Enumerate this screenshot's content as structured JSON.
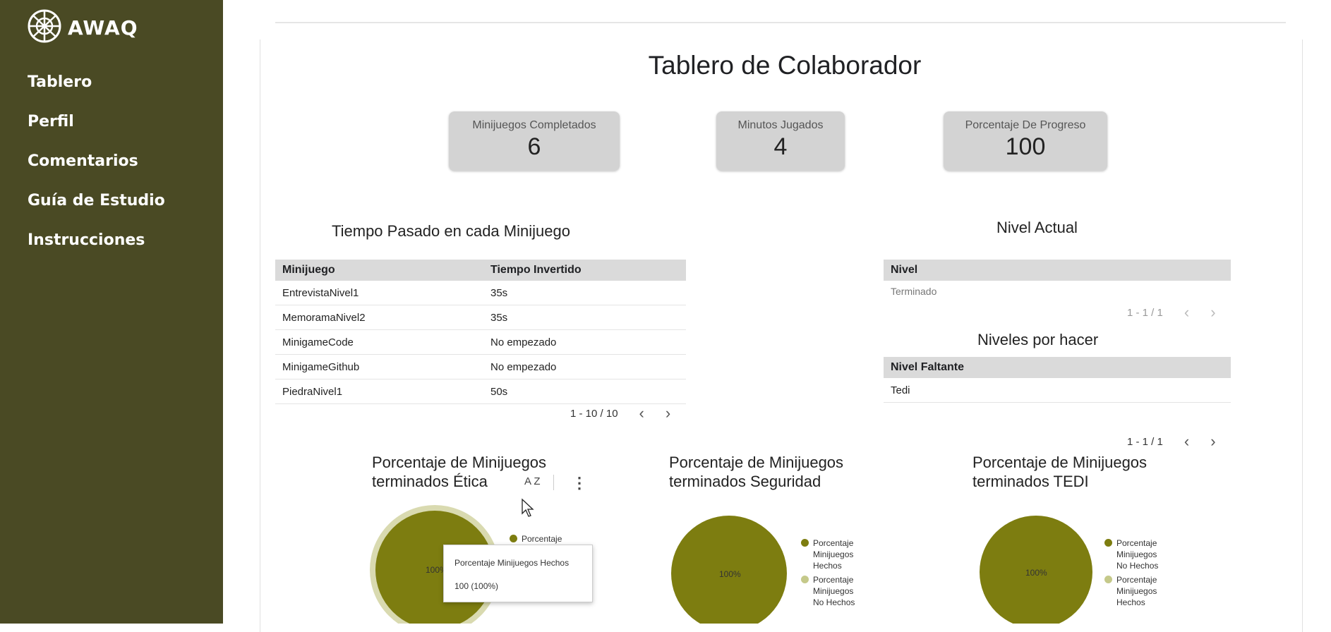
{
  "app": {
    "logo_text": "AWAQ"
  },
  "sidebar": {
    "items": [
      {
        "label": "Tablero"
      },
      {
        "label": "Perfil"
      },
      {
        "label": "Comentarios"
      },
      {
        "label": "Guía de Estudio"
      },
      {
        "label": "Instrucciones"
      }
    ]
  },
  "main": {
    "title": "Tablero de Colaborador",
    "kpis": [
      {
        "label": "Minijuegos Completados",
        "value": "6"
      },
      {
        "label": "Minutos Jugados",
        "value": "4"
      },
      {
        "label": "Porcentaje De Progreso",
        "value": "100"
      }
    ],
    "time_table": {
      "title": "Tiempo Pasado en cada Minijuego",
      "headers": [
        "Minijuego",
        "Tiempo Invertido"
      ],
      "rows": [
        [
          "EntrevistaNivel1",
          "35s"
        ],
        [
          "MemoramaNivel2",
          "35s"
        ],
        [
          "MinigameCode",
          "No empezado"
        ],
        [
          "MinigameGithub",
          "No empezado"
        ],
        [
          "PiedraNivel1",
          "50s"
        ]
      ],
      "pager": "1 - 10 / 10"
    },
    "level_table": {
      "title": "Nivel Actual",
      "header": "Nivel",
      "rows": [
        "Terminado"
      ],
      "pager": "1 - 1 / 1"
    },
    "todo_table": {
      "title": "Niveles por hacer",
      "header": "Nivel Faltante",
      "rows": [
        "Tedi"
      ],
      "pager": "1 - 1 / 1"
    },
    "charts": [
      {
        "title_line1": "Porcentaje de Minijuegos",
        "title_line2": "terminados Ética",
        "slice_label": "100%",
        "legend": [
          {
            "label": "Porcentaje",
            "color": "#7d7d10"
          }
        ],
        "tooltip": {
          "line1": "Porcentaje Minijuegos Hechos",
          "line2": "100 (100%)"
        }
      },
      {
        "title_line1": "Porcentaje de Minijuegos",
        "title_line2": "terminados Seguridad",
        "slice_label": "100%",
        "legend": [
          {
            "line1": "Porcentaje",
            "line2": "Minijuegos",
            "line3": "Hechos",
            "color": "#7d7d10"
          },
          {
            "line1": "Porcentaje",
            "line2": "Minijuegos",
            "line3": "No Hechos",
            "color": "#c5c98a"
          }
        ]
      },
      {
        "title_line1": "Porcentaje de Minijuegos",
        "title_line2": "terminados TEDI",
        "slice_label": "100%",
        "legend": [
          {
            "line1": "Porcentaje",
            "line2": "Minijuegos",
            "line3": "No Hechos",
            "color": "#7d7d10"
          },
          {
            "line1": "Porcentaje",
            "line2": "Minijuegos",
            "line3": "Hechos",
            "color": "#c5c98a"
          }
        ]
      }
    ],
    "chart_toolbar": {
      "sort_glyph": "A Z"
    }
  },
  "colors": {
    "sidebar": "#4a4a24",
    "pie": "#7d7d10",
    "pie_secondary": "#c5c98a",
    "kpi_bg": "#d3d3d3"
  }
}
